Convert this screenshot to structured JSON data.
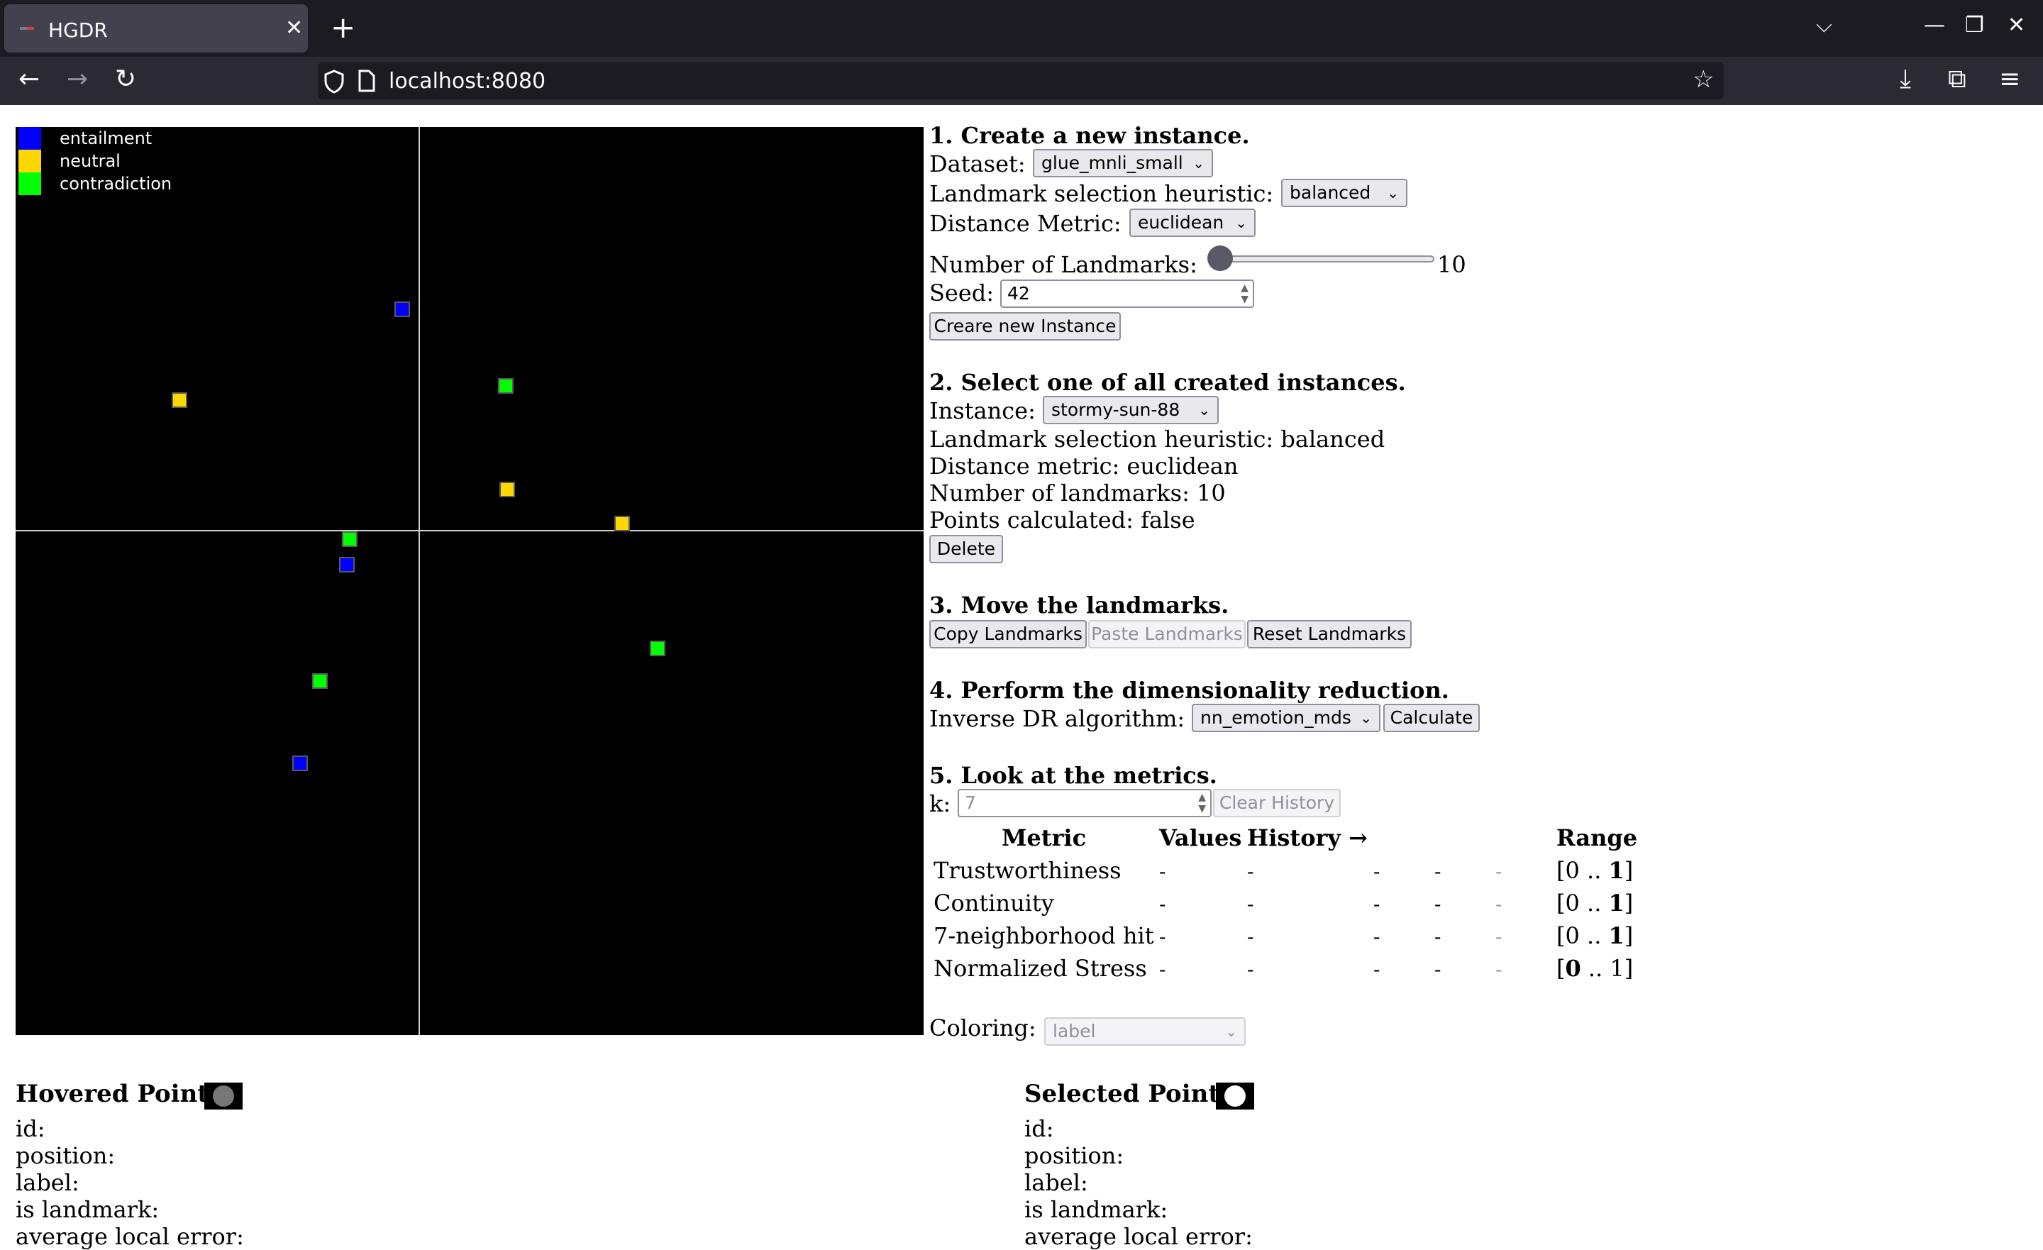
{
  "browser": {
    "tab_title": "HGDR",
    "url": "localhost:8080"
  },
  "legend": [
    {
      "label": "entailment",
      "color": "#0000ff"
    },
    {
      "label": "neutral",
      "color": "#ffd700"
    },
    {
      "label": "contradiction",
      "color": "#00ff00"
    }
  ],
  "points": [
    {
      "label": "entailment"
    },
    {
      "label": "neutral"
    },
    {
      "label": "contradiction"
    },
    {
      "label": "neutral"
    },
    {
      "label": "neutral"
    },
    {
      "label": "contradiction"
    },
    {
      "label": "entailment"
    },
    {
      "label": "contradiction"
    },
    {
      "label": "contradiction"
    },
    {
      "label": "entailment"
    }
  ],
  "section1": {
    "heading": "1. Create a new instance.",
    "dataset_label": "Dataset:",
    "dataset_value": "glue_mnli_small",
    "heuristic_label": "Landmark selection heuristic:",
    "heuristic_value": "balanced",
    "metric_label": "Distance Metric:",
    "metric_value": "euclidean",
    "landmarks_label": "Number of Landmarks:",
    "landmarks_value": "10",
    "seed_label": "Seed:",
    "seed_value": "42",
    "create_button": "Creare new Instance"
  },
  "section2": {
    "heading": "2. Select one of all created instances.",
    "instance_label": "Instance:",
    "instance_value": "stormy-sun-88",
    "heuristic_line": "Landmark selection heuristic: balanced",
    "metric_line": "Distance metric: euclidean",
    "landmarks_line": "Number of landmarks: 10",
    "points_line": "Points calculated: false",
    "delete_button": "Delete"
  },
  "section3": {
    "heading": "3. Move the landmarks.",
    "copy_button": "Copy Landmarks",
    "paste_button": "Paste Landmarks",
    "reset_button": "Reset Landmarks"
  },
  "section4": {
    "heading": "4. Perform the dimensionality reduction.",
    "algo_label": "Inverse DR algorithm:",
    "algo_value": "nn_emotion_mds",
    "calculate_button": "Calculate"
  },
  "section5": {
    "heading": "5. Look at the metrics.",
    "k_label": "k:",
    "k_value": "7",
    "clear_button": "Clear History",
    "col_metric": "Metric",
    "col_values": "Values",
    "col_history": "History →",
    "col_range": "Range",
    "rows": [
      {
        "name": "Trustworthiness",
        "value": "-",
        "h1": "-",
        "h2": "-",
        "h3": "-",
        "h4": "-",
        "r_lo": "0",
        "r_hi": "1",
        "best": "hi"
      },
      {
        "name": "Continuity",
        "value": "-",
        "h1": "-",
        "h2": "-",
        "h3": "-",
        "h4": "-",
        "r_lo": "0",
        "r_hi": "1",
        "best": "hi"
      },
      {
        "name": "7-neighborhood hit",
        "value": "-",
        "h1": "-",
        "h2": "-",
        "h3": "-",
        "h4": "-",
        "r_lo": "0",
        "r_hi": "1",
        "best": "hi"
      },
      {
        "name": "Normalized Stress",
        "value": "-",
        "h1": "-",
        "h2": "-",
        "h3": "-",
        "h4": "-",
        "r_lo": "0",
        "r_hi": "1",
        "best": "lo"
      }
    ],
    "range_open": "[",
    "range_sep": " .. ",
    "range_close": "]"
  },
  "coloring": {
    "label": "Coloring:",
    "value": "label"
  },
  "hovered": {
    "title": "Hovered Point",
    "id": "id:",
    "position": "position:",
    "label": "label:",
    "is_landmark": "is landmark:",
    "avg_error": "average local error:"
  },
  "selected": {
    "title": "Selected Point",
    "id": "id:",
    "position": "position:",
    "label": "label:",
    "is_landmark": "is landmark:",
    "avg_error": "average local error:"
  }
}
